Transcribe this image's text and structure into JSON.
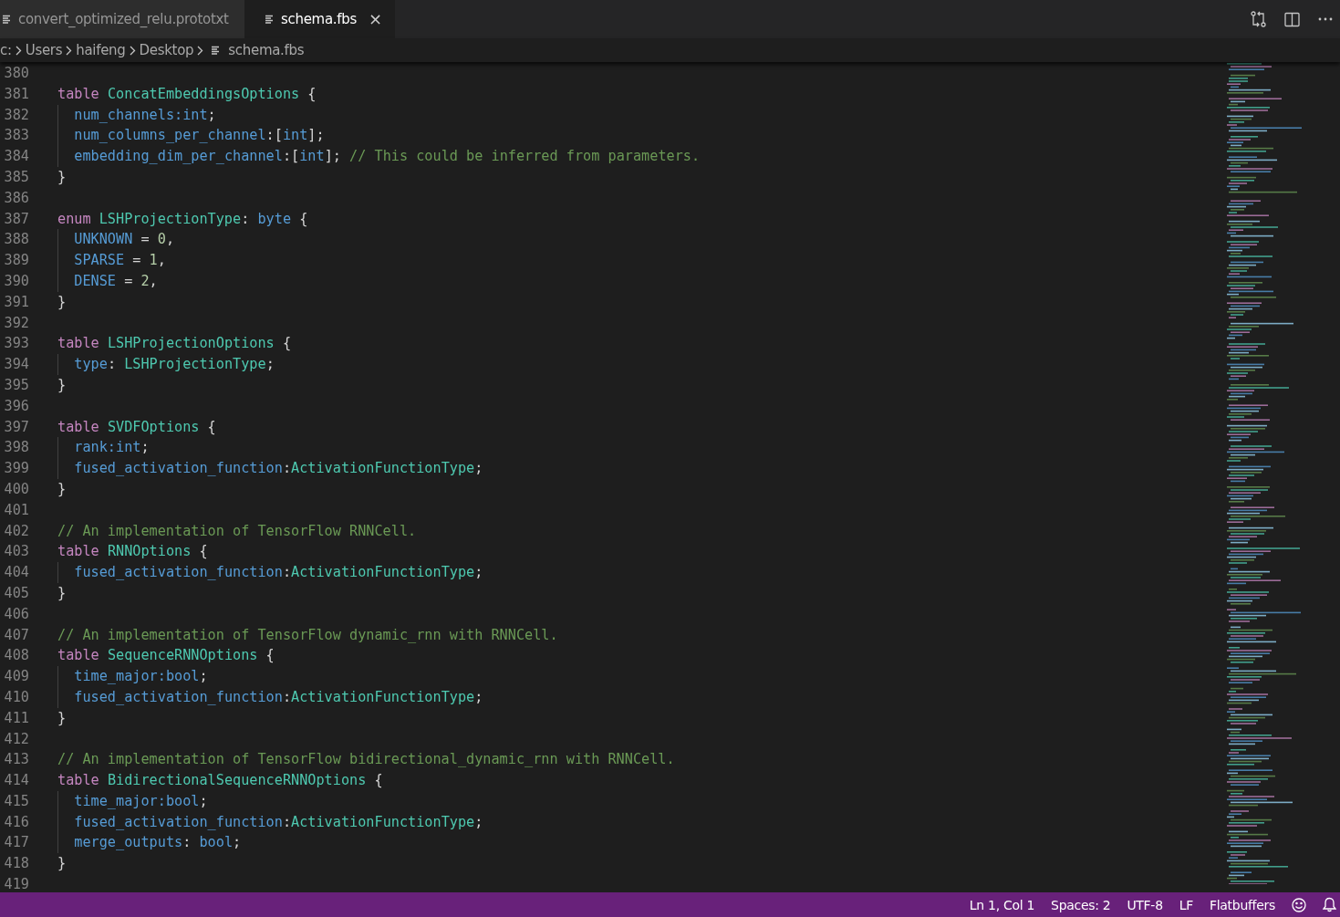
{
  "tabs": [
    {
      "label": "convert_optimized_relu.prototxt",
      "selected": false
    },
    {
      "label": "schema.fbs",
      "selected": true,
      "close": "×"
    }
  ],
  "breadcrumbs": [
    {
      "kind": "folder",
      "label": "c:"
    },
    {
      "kind": "folder",
      "label": "Users"
    },
    {
      "kind": "folder",
      "label": "haifeng"
    },
    {
      "kind": "folder",
      "label": "Desktop"
    },
    {
      "kind": "file",
      "label": "schema.fbs"
    }
  ],
  "lines": [
    {
      "number": "380",
      "indented": false
    },
    {
      "number": "381",
      "indented": false,
      "tokens": [
        {
          "kind": "keyword",
          "text": "table "
        },
        {
          "kind": "type",
          "text": "ConcatEmbeddingsOptions"
        },
        {
          "kind": "punct",
          "text": " {"
        }
      ]
    },
    {
      "number": "382",
      "indented": true,
      "tokens": [
        {
          "kind": "field",
          "text": "num_channels:int"
        },
        {
          "kind": "punct",
          "text": ";"
        }
      ]
    },
    {
      "number": "383",
      "indented": true,
      "tokens": [
        {
          "kind": "field",
          "text": "num_columns_per_channel"
        },
        {
          "kind": "punct",
          "text": ":["
        },
        {
          "kind": "field",
          "text": "int"
        },
        {
          "kind": "punct",
          "text": "];"
        }
      ]
    },
    {
      "number": "384",
      "indented": true,
      "tokens": [
        {
          "kind": "field",
          "text": "embedding_dim_per_channel"
        },
        {
          "kind": "punct",
          "text": ":["
        },
        {
          "kind": "field",
          "text": "int"
        },
        {
          "kind": "punct",
          "text": "]; "
        },
        {
          "kind": "comment",
          "text": "// This could be inferred from parameters."
        }
      ]
    },
    {
      "number": "385",
      "indented": false,
      "tokens": [
        {
          "kind": "punct",
          "text": "}"
        }
      ]
    },
    {
      "number": "386",
      "indented": false
    },
    {
      "number": "387",
      "indented": false,
      "tokens": [
        {
          "kind": "keyword",
          "text": "enum "
        },
        {
          "kind": "type",
          "text": "LSHProjectionType"
        },
        {
          "kind": "punct",
          "text": ": "
        },
        {
          "kind": "field",
          "text": "byte"
        },
        {
          "kind": "punct",
          "text": " {"
        }
      ]
    },
    {
      "number": "388",
      "indented": true,
      "tokens": [
        {
          "kind": "field",
          "text": "UNKNOWN"
        },
        {
          "kind": "punct",
          "text": " = "
        },
        {
          "kind": "number",
          "text": "0"
        },
        {
          "kind": "punct",
          "text": ","
        }
      ]
    },
    {
      "number": "389",
      "indented": true,
      "tokens": [
        {
          "kind": "field",
          "text": "SPARSE"
        },
        {
          "kind": "punct",
          "text": " = "
        },
        {
          "kind": "number",
          "text": "1"
        },
        {
          "kind": "punct",
          "text": ","
        }
      ]
    },
    {
      "number": "390",
      "indented": true,
      "tokens": [
        {
          "kind": "field",
          "text": "DENSE"
        },
        {
          "kind": "punct",
          "text": " = "
        },
        {
          "kind": "number",
          "text": "2"
        },
        {
          "kind": "punct",
          "text": ","
        }
      ]
    },
    {
      "number": "391",
      "indented": false,
      "tokens": [
        {
          "kind": "punct",
          "text": "}"
        }
      ]
    },
    {
      "number": "392",
      "indented": false
    },
    {
      "number": "393",
      "indented": false,
      "tokens": [
        {
          "kind": "keyword",
          "text": "table "
        },
        {
          "kind": "type",
          "text": "LSHProjectionOptions"
        },
        {
          "kind": "punct",
          "text": " {"
        }
      ]
    },
    {
      "number": "394",
      "indented": true,
      "tokens": [
        {
          "kind": "field",
          "text": "type"
        },
        {
          "kind": "punct",
          "text": ": "
        },
        {
          "kind": "type",
          "text": "LSHProjectionType"
        },
        {
          "kind": "punct",
          "text": ";"
        }
      ]
    },
    {
      "number": "395",
      "indented": false,
      "tokens": [
        {
          "kind": "punct",
          "text": "}"
        }
      ]
    },
    {
      "number": "396",
      "indented": false
    },
    {
      "number": "397",
      "indented": false,
      "tokens": [
        {
          "kind": "keyword",
          "text": "table "
        },
        {
          "kind": "type",
          "text": "SVDFOptions"
        },
        {
          "kind": "punct",
          "text": " {"
        }
      ]
    },
    {
      "number": "398",
      "indented": true,
      "tokens": [
        {
          "kind": "field",
          "text": "rank:int"
        },
        {
          "kind": "punct",
          "text": ";"
        }
      ]
    },
    {
      "number": "399",
      "indented": true,
      "tokens": [
        {
          "kind": "field",
          "text": "fused_activation_function"
        },
        {
          "kind": "punct",
          "text": ":"
        },
        {
          "kind": "type",
          "text": "ActivationFunctionType"
        },
        {
          "kind": "punct",
          "text": ";"
        }
      ]
    },
    {
      "number": "400",
      "indented": false,
      "tokens": [
        {
          "kind": "punct",
          "text": "}"
        }
      ]
    },
    {
      "number": "401",
      "indented": false
    },
    {
      "number": "402",
      "indented": false,
      "tokens": [
        {
          "kind": "comment",
          "text": "// An implementation of TensorFlow RNNCell."
        }
      ]
    },
    {
      "number": "403",
      "indented": false,
      "tokens": [
        {
          "kind": "keyword",
          "text": "table "
        },
        {
          "kind": "type",
          "text": "RNNOptions"
        },
        {
          "kind": "punct",
          "text": " {"
        }
      ]
    },
    {
      "number": "404",
      "indented": true,
      "tokens": [
        {
          "kind": "field",
          "text": "fused_activation_function"
        },
        {
          "kind": "punct",
          "text": ":"
        },
        {
          "kind": "type",
          "text": "ActivationFunctionType"
        },
        {
          "kind": "punct",
          "text": ";"
        }
      ]
    },
    {
      "number": "405",
      "indented": false,
      "tokens": [
        {
          "kind": "punct",
          "text": "}"
        }
      ]
    },
    {
      "number": "406",
      "indented": false
    },
    {
      "number": "407",
      "indented": false,
      "tokens": [
        {
          "kind": "comment",
          "text": "// An implementation of TensorFlow dynamic_rnn with RNNCell."
        }
      ]
    },
    {
      "number": "408",
      "indented": false,
      "tokens": [
        {
          "kind": "keyword",
          "text": "table "
        },
        {
          "kind": "type",
          "text": "SequenceRNNOptions"
        },
        {
          "kind": "punct",
          "text": " {"
        }
      ]
    },
    {
      "number": "409",
      "indented": true,
      "tokens": [
        {
          "kind": "field",
          "text": "time_major:bool"
        },
        {
          "kind": "punct",
          "text": ";"
        }
      ]
    },
    {
      "number": "410",
      "indented": true,
      "tokens": [
        {
          "kind": "field",
          "text": "fused_activation_function"
        },
        {
          "kind": "punct",
          "text": ":"
        },
        {
          "kind": "type",
          "text": "ActivationFunctionType"
        },
        {
          "kind": "punct",
          "text": ";"
        }
      ]
    },
    {
      "number": "411",
      "indented": false,
      "tokens": [
        {
          "kind": "punct",
          "text": "}"
        }
      ]
    },
    {
      "number": "412",
      "indented": false
    },
    {
      "number": "413",
      "indented": false,
      "tokens": [
        {
          "kind": "comment",
          "text": "// An implementation of TensorFlow bidirectional_dynamic_rnn with RNNCell."
        }
      ]
    },
    {
      "number": "414",
      "indented": false,
      "tokens": [
        {
          "kind": "keyword",
          "text": "table "
        },
        {
          "kind": "type",
          "text": "BidirectionalSequenceRNNOptions"
        },
        {
          "kind": "punct",
          "text": " {"
        }
      ]
    },
    {
      "number": "415",
      "indented": true,
      "tokens": [
        {
          "kind": "field",
          "text": "time_major:bool"
        },
        {
          "kind": "punct",
          "text": ";"
        }
      ]
    },
    {
      "number": "416",
      "indented": true,
      "tokens": [
        {
          "kind": "field",
          "text": "fused_activation_function"
        },
        {
          "kind": "punct",
          "text": ":"
        },
        {
          "kind": "type",
          "text": "ActivationFunctionType"
        },
        {
          "kind": "punct",
          "text": ";"
        }
      ]
    },
    {
      "number": "417",
      "indented": true,
      "tokens": [
        {
          "kind": "field",
          "text": "merge_outputs"
        },
        {
          "kind": "punct",
          "text": ": "
        },
        {
          "kind": "field",
          "text": "bool"
        },
        {
          "kind": "punct",
          "text": ";"
        }
      ]
    },
    {
      "number": "418",
      "indented": false,
      "tokens": [
        {
          "kind": "punct",
          "text": "}"
        }
      ]
    },
    {
      "number": "419",
      "indented": false
    }
  ],
  "status_bar": [
    "Ln 1, Col 1",
    "Spaces: 2",
    "UTF-8",
    "LF",
    "Flatbuffers"
  ]
}
